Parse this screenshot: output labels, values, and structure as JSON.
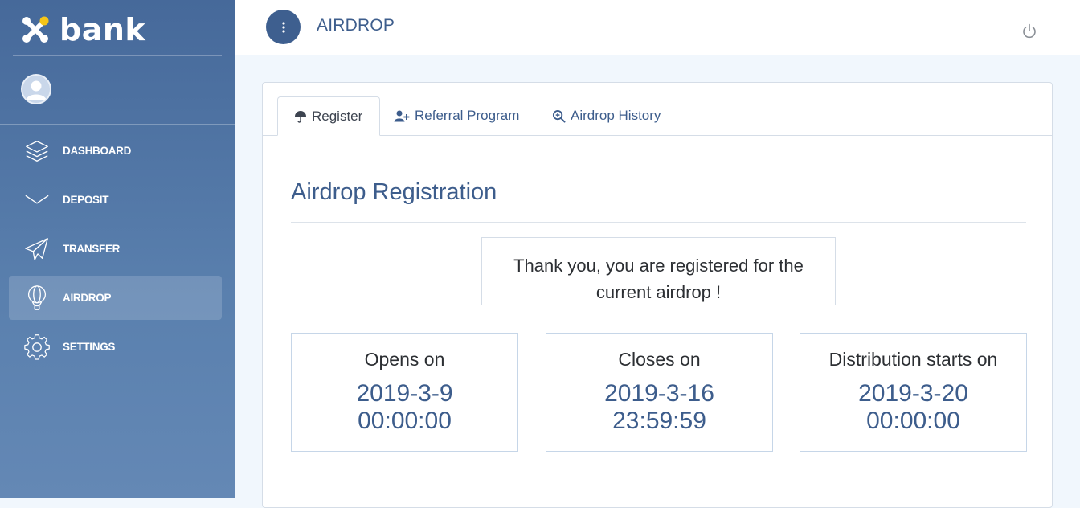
{
  "brand": {
    "name": "bank"
  },
  "sidebar": {
    "items": [
      {
        "label": "DASHBOARD",
        "icon": "layers-icon"
      },
      {
        "label": "DEPOSIT",
        "icon": "chevron-down-icon"
      },
      {
        "label": "TRANSFER",
        "icon": "paper-plane-icon"
      },
      {
        "label": "AIRDROP",
        "icon": "balloon-icon",
        "active": true
      },
      {
        "label": "SETTINGS",
        "icon": "gear-icon"
      }
    ]
  },
  "header": {
    "title": "AIRDROP"
  },
  "tabs": [
    {
      "label": "Register",
      "icon": "umbrella-icon",
      "active": true
    },
    {
      "label": "Referral Program",
      "icon": "user-plus-icon"
    },
    {
      "label": "Airdrop History",
      "icon": "search-plus-icon"
    }
  ],
  "content": {
    "title": "Airdrop Registration",
    "notice_line1": "Thank you, you are registered for the",
    "notice_line2": "current airdrop !",
    "dates": [
      {
        "label": "Opens on",
        "date": "2019-3-9",
        "time": "00:00:00"
      },
      {
        "label": "Closes on",
        "date": "2019-3-16",
        "time": "23:59:59"
      },
      {
        "label": "Distribution starts on",
        "date": "2019-3-20",
        "time": "00:00:00"
      }
    ]
  },
  "colors": {
    "sidebar_top": "#46699a",
    "sidebar_bottom": "#6488b5",
    "accent": "#3d5d8c",
    "logo_yellow": "#f5c518"
  }
}
